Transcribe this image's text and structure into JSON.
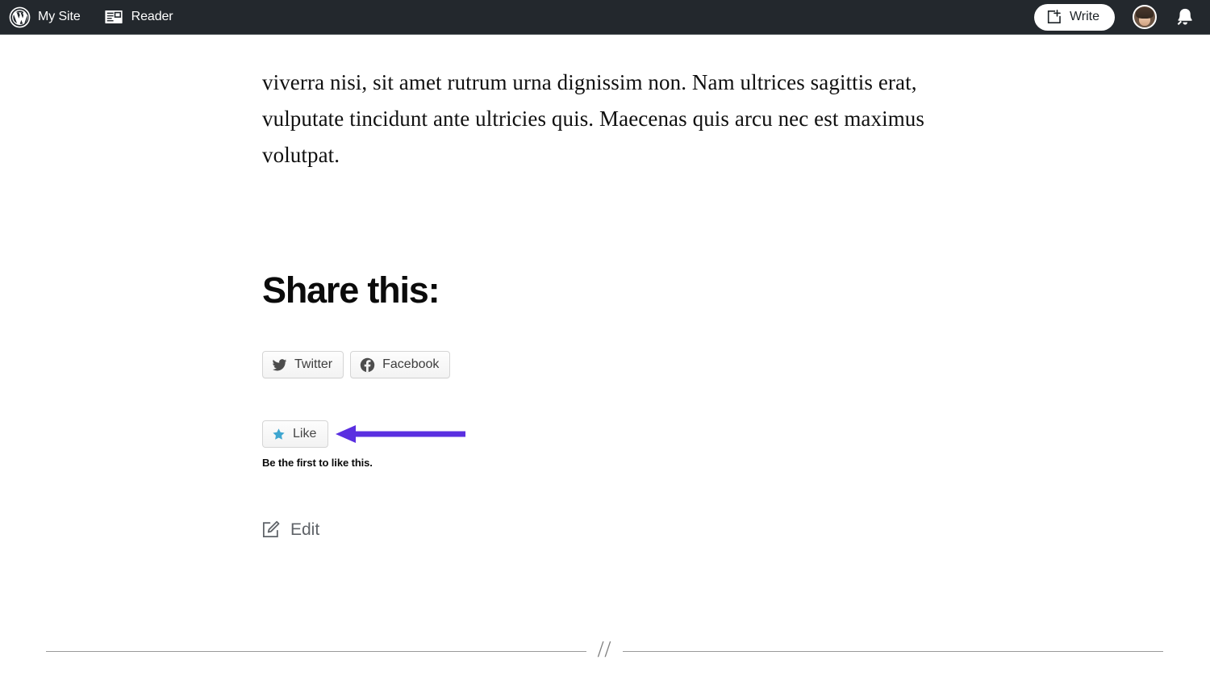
{
  "masterbar": {
    "background_color": "#23282d",
    "items": [
      {
        "label": "My Site",
        "icon": "wordpress-logo-icon"
      },
      {
        "label": "Reader",
        "icon": "reader-icon"
      }
    ],
    "write_button": {
      "label": "Write",
      "icon": "write-plus-icon"
    },
    "avatar": {
      "name": "user-avatar"
    },
    "notifications": {
      "icon": "bell-icon"
    }
  },
  "post": {
    "body_text": "viverra nisi, sit amet rutrum urna dignissim non. Nam ultrices sagittis erat, vulputate tincidunt ante ultricies quis. Maecenas quis arcu nec est maximus volutpat."
  },
  "share": {
    "heading": "Share this:",
    "buttons": [
      {
        "label": "Twitter",
        "icon": "twitter-bird-icon"
      },
      {
        "label": "Facebook",
        "icon": "facebook-circle-icon"
      }
    ]
  },
  "like": {
    "button_label": "Like",
    "icon": "star-icon",
    "star_color": "#3ea6d0",
    "count_text": "Be the first to like this."
  },
  "annotation": {
    "arrow_color": "#5a2fe0",
    "points_to": "like-button"
  },
  "edit": {
    "label": "Edit",
    "icon": "pencil-square-edit-icon"
  },
  "separator": {
    "mark": "//"
  }
}
